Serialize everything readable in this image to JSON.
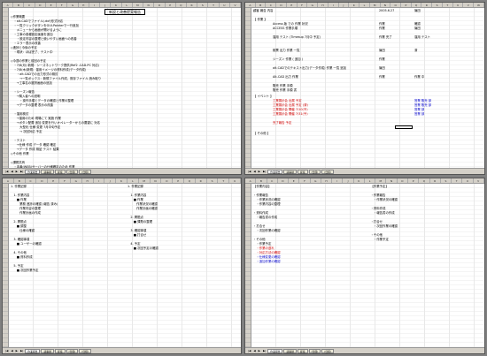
{
  "columns_tl": [
    "A",
    "B",
    "C",
    "D",
    "E",
    "F",
    "G",
    "H",
    "I",
    "J",
    "K",
    "L",
    "M",
    "N",
    "O",
    "P",
    "Q",
    "R",
    "S",
    "T",
    "U",
    "V"
  ],
  "columns_tr": [
    "A",
    "B",
    "C",
    "D",
    "E",
    "F",
    "G",
    "H",
    "I",
    "J",
    "K",
    "L",
    "M",
    "N",
    "O",
    "P",
    "Q",
    "R",
    "S",
    "T",
    "U",
    "V",
    "W"
  ],
  "columns_bl": [
    "A",
    "B",
    "C",
    "D",
    "E",
    "F",
    "G",
    "H",
    "I",
    "J",
    "K",
    "L",
    "M",
    "N",
    "O",
    "P",
    "Q",
    "R",
    "S",
    "T",
    "U"
  ],
  "columns_br": [
    "A",
    "B",
    "C",
    "D",
    "E",
    "F",
    "G",
    "H",
    "I",
    "J",
    "K",
    "L",
    "M",
    "N",
    "O",
    "P",
    "Q",
    "R",
    "S",
    "T",
    "U",
    "V"
  ],
  "tl": {
    "title": "新設と改善提案報告",
    "lines": [
      "◇作業概要",
      "　・alt-CADでファイル(.dxf)形式対応",
      "　・一覧クリックボタンをGUI-Painterで一行追加",
      "　　メニューから画面が開けるように",
      "　・工事の各種設定画面を追加",
      "　　・設定内容の整理と使いやすい画面への改善",
      "　・エラー表示の改善",
      "◇進捗と今後の予定",
      "　・現状：ほぼ完了、テスト中",
      "",
      "◇今週の作業と前回の予定",
      "　・7/6(月) 新規：シーズネットワーク提供(Ref2 -CAD-PC 対応)",
      "　・7/8(木)新規：運用イメージの資料作成(データ作成)",
      "　　・alt-CADでの出力形式の検討",
      "　　　→一覧ボックス：新規ファイル作成、既存ファイル 読み取り",
      "　　→工事名の選択画面の追加",
      "",
      "　・シーズン報告",
      "　　→購入者への説明",
      "　　　・操作手順とデータの確認と作業の整理",
      "　　→データの整理 表示の改善",
      "",
      "　・運用検討",
      "　　→運用のため 現場にて 実施 作業",
      "　　→ボタン配置 追加 変更を行いオペレーターからの要望に 対応",
      "　　　大型化 仕様 変更 7月中旬予定",
      "　　　→ 次回対応 予定",
      "",
      "　・テスト",
      "　　→仕様 作成 データ 確認 確定",
      "　　→データ 作成 検証 テスト 結果",
      "◇その他 作業",
      "",
      "◇課題共有",
      "　・本番(WEB)サーバーの仕様確定のため 作業",
      "　　→7/10 に作業 予定",
      "　・開発 環境の 準備",
      "　　→ サーバー 調達 について",
      "　　→ 先方へ確認 中"
    ]
  },
  "tr": {
    "header_rows": [
      {
        "a": "顧客 報告 内容",
        "b": "",
        "c": "2005.6.27",
        "d": "篠田"
      },
      {
        "a": "",
        "b": "",
        "c": "",
        "d": ""
      },
      {
        "a": "【 作業 】",
        "b": "",
        "c": "",
        "d": ""
      },
      {
        "a": "",
        "b": "Access 版 での 作業 状況",
        "c": "作業",
        "d": "確認"
      },
      {
        "a": "",
        "b": "ACCESS 作業手順",
        "c": "作業",
        "d": "篠田"
      },
      {
        "a": "",
        "b": "",
        "c": "",
        "d": ""
      },
      {
        "a": "",
        "b": "運用 テスト (Timesup 7月中 予定)",
        "c": "作業 完了",
        "d": "運用 テスト"
      },
      {
        "a": "",
        "b": "",
        "c": "",
        "d": ""
      },
      {
        "a": "",
        "b": "",
        "c": "",
        "d": ""
      },
      {
        "a": "",
        "b": "帳票 出力 作業 一覧",
        "c": "篠田",
        "d": "済"
      },
      {
        "a": "",
        "b": "",
        "c": "",
        "d": ""
      },
      {
        "a": "",
        "b": "シーズン 作業 ( 追加 )",
        "c": "作業",
        "d": ""
      },
      {
        "a": "",
        "b": "",
        "c": "",
        "d": ""
      },
      {
        "a": "",
        "b": "alt-CADでのテキスト出力(データ作成) 作業 一覧 追加",
        "c": "篠田",
        "d": ""
      },
      {
        "a": "",
        "b": "",
        "c": "",
        "d": ""
      },
      {
        "a": "",
        "b": "Alt-CAD 出力 作業",
        "c": "作業",
        "d": "作業 中"
      },
      {
        "a": "",
        "b": "",
        "c": "",
        "d": ""
      },
      {
        "a": "",
        "b": "販売 作業 手順",
        "c": "",
        "d": ""
      },
      {
        "a": "",
        "b": "販売 作業 手順 書",
        "c": "",
        "d": ""
      }
    ],
    "event_header": "【 イベント 】",
    "event_rows": [
      {
        "b": "工業展示会 出展 予定",
        "c": "",
        "d": "営業 販売 部"
      },
      {
        "b": "工業展示会 出展 予定 (済)",
        "c": "",
        "d": "営業 販売 部"
      },
      {
        "b": "工業展示会 開催 7/10(予)",
        "c": "",
        "d": "営業 部"
      },
      {
        "b": "工業展示会 開催 7/31(予)",
        "c": "",
        "d": "営業 部"
      },
      {
        "b": "",
        "c": "",
        "d": ""
      },
      {
        "b": "完了報告 予定",
        "c": "",
        "d": ""
      }
    ],
    "other_header": "【 その他 】"
  },
  "bl": {
    "title": "1. 作業記録",
    "left_lines": [
      "1. 作業記録",
      "",
      "　1. 作業内容",
      "　　■ 作業",
      "　　　業務 進捗の確認 (報告 済み)",
      "　　　作業内容の整理",
      "　　　作業計画の作成",
      "",
      "　2. 問題点",
      "　　■ 調整",
      "　　　仕様の確認",
      "",
      "　3. 確認事項",
      "　　■ ユーザーの確認",
      "",
      "　4. その他",
      "　　■ 資料作成",
      "",
      "　5. 予定",
      "　　■ 次回作業予定"
    ],
    "right_lines": [
      "1. 作業記録",
      "",
      "　1. 作業内容",
      "　　■ 作業",
      "　　　作業状況の確認",
      "　　　作業計画の確認",
      "",
      "　2. 問題点",
      "　　■ 課題の整理",
      "",
      "　3. 確認事項",
      "　　■ 打合せ",
      "",
      "　4. 予定",
      "　　■ 次回予定の確認"
    ]
  },
  "br": {
    "left_lines": [
      "【作業内容】",
      "",
      "・作業報告",
      "　・作業状況の確認",
      "　・作業内容の整理",
      "",
      "・資料作成",
      "　・報告書の作成",
      "",
      "・打合せ",
      "　・次回作業の確認",
      "",
      "・その他",
      "　・作業予定"
    ],
    "left_red": [
      "　・作業の遅れ",
      "　・対応方法の確認"
    ],
    "left_blue": [
      "　・仕様変更の確認",
      "　・追加作業の確認"
    ],
    "right_lines": [
      "【作業予定】",
      "",
      "・作業報告",
      "　・作業状況の確認",
      "",
      "・資料作成",
      "　・報告書の作成",
      "",
      "・打合せ",
      "　・次回作業の確認",
      "",
      "・その他",
      "　・作業予定"
    ]
  },
  "tabs_tl": [
    "作業報告",
    "議事録",
    "提案",
    "(仕様)",
    "(仕様)"
  ],
  "tabs_tr": [
    "作業報告",
    "議事録",
    "提案",
    "(仕様)",
    "(仕様)"
  ],
  "tabs_bl": [
    "作業報告",
    "議事録",
    "提案",
    "(仕様)",
    "(仕様)"
  ],
  "tabs_br": [
    "作業報告",
    "議事録",
    "提案",
    "(仕様)",
    "(仕様)"
  ],
  "nav_glyphs": [
    "|◀",
    "◀",
    "▶",
    "▶|"
  ]
}
